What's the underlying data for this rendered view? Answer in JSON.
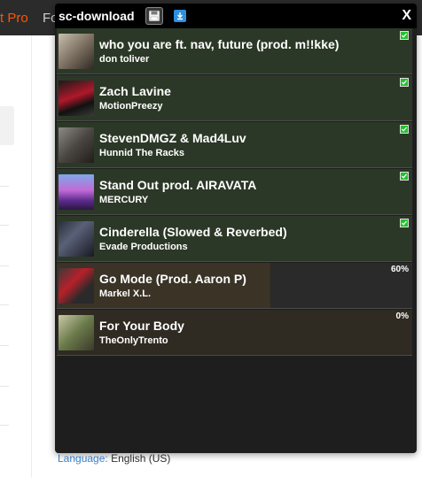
{
  "background": {
    "topbar_left_text": "t Pro",
    "topbar_second_text": "Fo",
    "language_label": "Language:",
    "language_value": "English (US)"
  },
  "panel": {
    "title": "sc-download",
    "save_icon": "floppy-disk-icon",
    "download_icon": "download-arrow-icon",
    "close_label": "X"
  },
  "tracks": [
    {
      "title": "who you are ft. nav, future (prod. m!!kke)",
      "artist": "don toliver",
      "status": "done",
      "progress": 1.0
    },
    {
      "title": "Zach Lavine",
      "artist": "MotionPreezy",
      "status": "done",
      "progress": 1.0
    },
    {
      "title": "StevenDMGZ & Mad4Luv",
      "artist": "Hunnid The Racks",
      "status": "done",
      "progress": 1.0
    },
    {
      "title": "Stand Out prod. AIRAVATA",
      "artist": "MERCURY",
      "status": "done",
      "progress": 1.0
    },
    {
      "title": "Cinderella (Slowed & Reverbed)",
      "artist": "Evade Productions",
      "status": "done",
      "progress": 1.0
    },
    {
      "title": "Go Mode (Prod. Aaron P)",
      "artist": "Markel X.L.",
      "status": "downloading",
      "progress_label": "60%",
      "progress": 0.6
    },
    {
      "title": "For Your Body",
      "artist": "TheOnlyTrento",
      "status": "downloading",
      "progress_label": "0%",
      "progress": 0.0
    }
  ],
  "colors": {
    "accent_orange": "#ff5500",
    "check_green": "#22c22a",
    "panel_bg": "#1e1e1e",
    "done_row_bg": "#2c3827"
  }
}
